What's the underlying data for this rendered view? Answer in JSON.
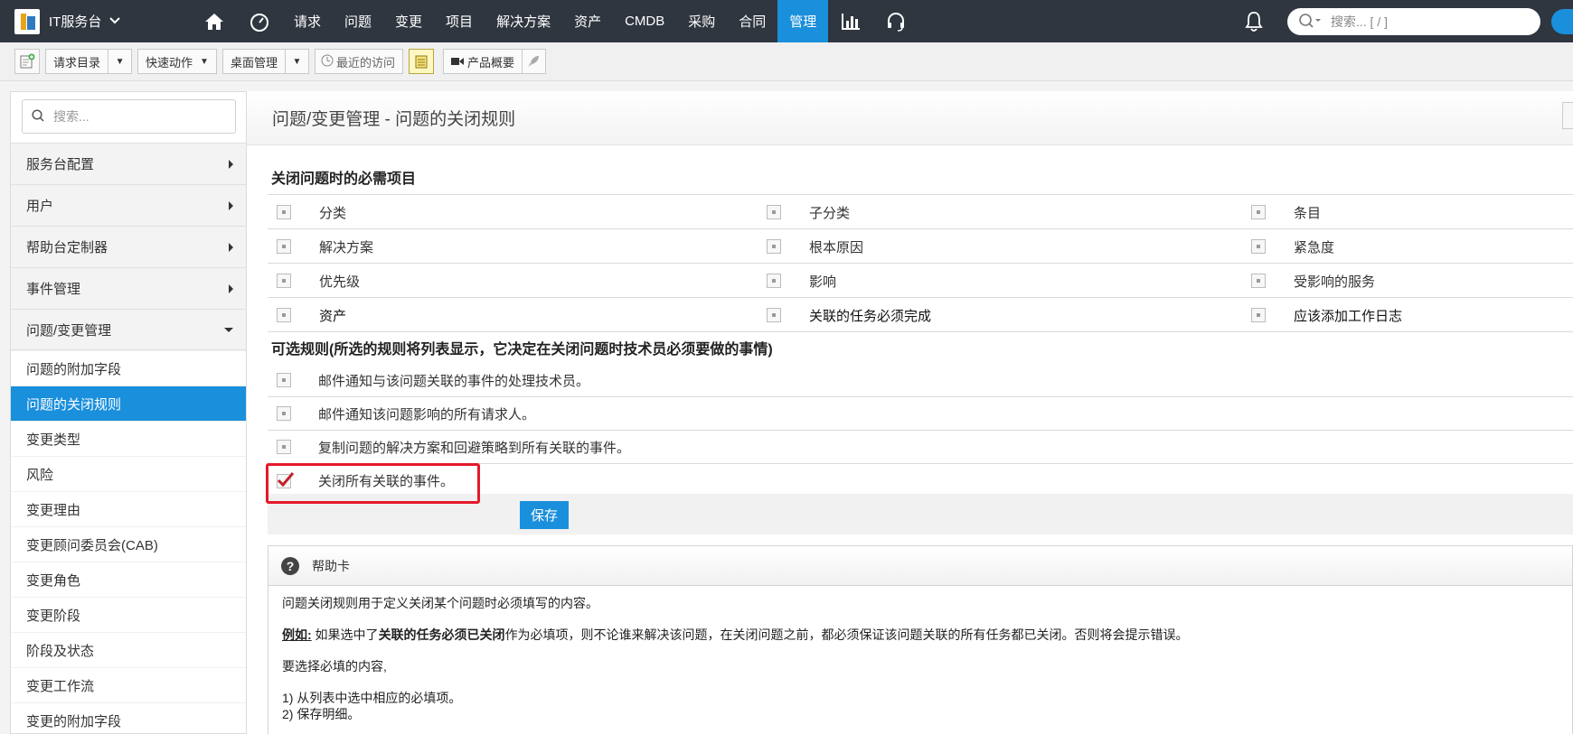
{
  "app": {
    "brand": "IT服务台",
    "nav": [
      "请求",
      "问题",
      "变更",
      "项目",
      "解决方案",
      "资产",
      "CMDB",
      "采购",
      "合同",
      "管理"
    ],
    "active_nav": "管理",
    "search_placeholder": "搜索... [ / ]"
  },
  "toolbar": {
    "request_catalog": "请求目录",
    "quick_actions": "快速动作",
    "desktop_mgmt": "桌面管理",
    "recent": "最近的访问",
    "product_overview": "产品概要"
  },
  "sidebar": {
    "search_placeholder": "搜索...",
    "headers": [
      "服务台配置",
      "用户",
      "帮助台定制器",
      "事件管理",
      "问题/变更管理"
    ],
    "subitems": [
      "问题的附加字段",
      "问题的关闭规则",
      "变更类型",
      "风险",
      "变更理由",
      "变更顾问委员会(CAB)",
      "变更角色",
      "变更阶段",
      "阶段及状态",
      "变更工作流",
      "变更的附加字段"
    ],
    "active_subitem": "问题的关闭规则"
  },
  "page": {
    "title": "问题/变更管理 - 问题的关闭规则",
    "required_title": "关闭问题时的必需项目",
    "required_rows": [
      [
        "分类",
        "子分类",
        "条目"
      ],
      [
        "解决方案",
        "根本原因",
        "紧急度"
      ],
      [
        "优先级",
        "影响",
        "受影响的服务"
      ],
      [
        "资产",
        "关联的任务必须完成",
        "应该添加工作日志"
      ]
    ],
    "optional_title": "可选规则(所选的规则将列表显示，它决定在关闭问题时技术员必须要做的事情)",
    "optional_rules": [
      {
        "label": "邮件通知与该问题关联的事件的处理技术员。",
        "checked": false
      },
      {
        "label": "邮件通知该问题影响的所有请求人。",
        "checked": false
      },
      {
        "label": "复制问题的解决方案和回避策略到所有关联的事件。",
        "checked": false
      },
      {
        "label": "关闭所有关联的事件。",
        "checked": true
      }
    ],
    "save_label": "保存"
  },
  "help": {
    "title": "帮助卡",
    "intro": "问题关闭规则用于定义关闭某个问题时必须填写的内容。",
    "example_label": "例如:",
    "example_pre": " 如果选中了",
    "example_bold": "关联的任务必须已关闭",
    "example_post": "作为必填项，则不论谁来解决该问题，在关闭问题之前，都必须保证该问题关联的所有任务都已关闭。否则将会提示错误。",
    "select_text": "要选择必填的内容,",
    "step1": "1)  从列表中选中相应的必填项。",
    "step2": "2)  保存明细。"
  },
  "colors": {
    "accent": "#1a8fdc",
    "topbar": "#2f3640",
    "highlight": "#e5192a",
    "checkmark": "#c2202b"
  }
}
